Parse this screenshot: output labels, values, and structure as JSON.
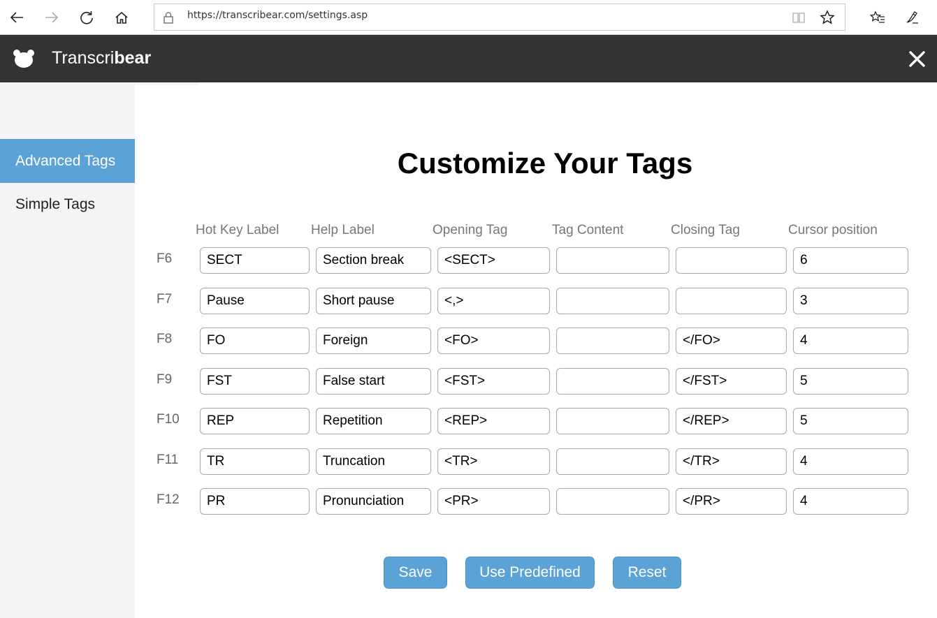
{
  "browser": {
    "url": "https://transcribear.com/settings.asp"
  },
  "app": {
    "title_regular": "Transcri",
    "title_bold": "bear"
  },
  "sidebar": {
    "items": [
      {
        "label": "Advanced Tags",
        "active": true
      },
      {
        "label": "Simple Tags",
        "active": false
      }
    ]
  },
  "main": {
    "title": "Customize Your Tags",
    "columns": [
      "Hot Key Label",
      "Help Label",
      "Opening Tag",
      "Tag Content",
      "Closing Tag",
      "Cursor position"
    ],
    "rows": [
      {
        "key": "F6",
        "hotkey": "SECT",
        "help": "Section break",
        "open": "<SECT>",
        "content": "",
        "close": "",
        "cursor": "6"
      },
      {
        "key": "F7",
        "hotkey": "Pause",
        "help": "Short pause",
        "open": "<,>",
        "content": "",
        "close": "",
        "cursor": "3"
      },
      {
        "key": "F8",
        "hotkey": "FO",
        "help": "Foreign",
        "open": "<FO>",
        "content": "",
        "close": "</FO>",
        "cursor": "4"
      },
      {
        "key": "F9",
        "hotkey": "FST",
        "help": "False start",
        "open": "<FST>",
        "content": "",
        "close": "</FST>",
        "cursor": "5"
      },
      {
        "key": "F10",
        "hotkey": "REP",
        "help": "Repetition",
        "open": "<REP>",
        "content": "",
        "close": "</REP>",
        "cursor": "5"
      },
      {
        "key": "F11",
        "hotkey": "TR",
        "help": "Truncation",
        "open": "<TR>",
        "content": "",
        "close": "</TR>",
        "cursor": "4"
      },
      {
        "key": "F12",
        "hotkey": "PR",
        "help": "Pronunciation",
        "open": "<PR>",
        "content": "",
        "close": "</PR>",
        "cursor": "4"
      }
    ],
    "buttons": {
      "save": "Save",
      "predefined": "Use Predefined",
      "reset": "Reset"
    }
  },
  "colors": {
    "accent": "#5ba3d6",
    "header": "#333333",
    "sidebar": "#f4f4f4"
  },
  "icons": [
    "back-arrow-icon",
    "forward-arrow-icon",
    "refresh-icon",
    "home-icon",
    "lock-icon",
    "reading-view-icon",
    "star-icon",
    "favorites-icon",
    "pen-icon",
    "bear-logo-icon",
    "close-icon"
  ]
}
